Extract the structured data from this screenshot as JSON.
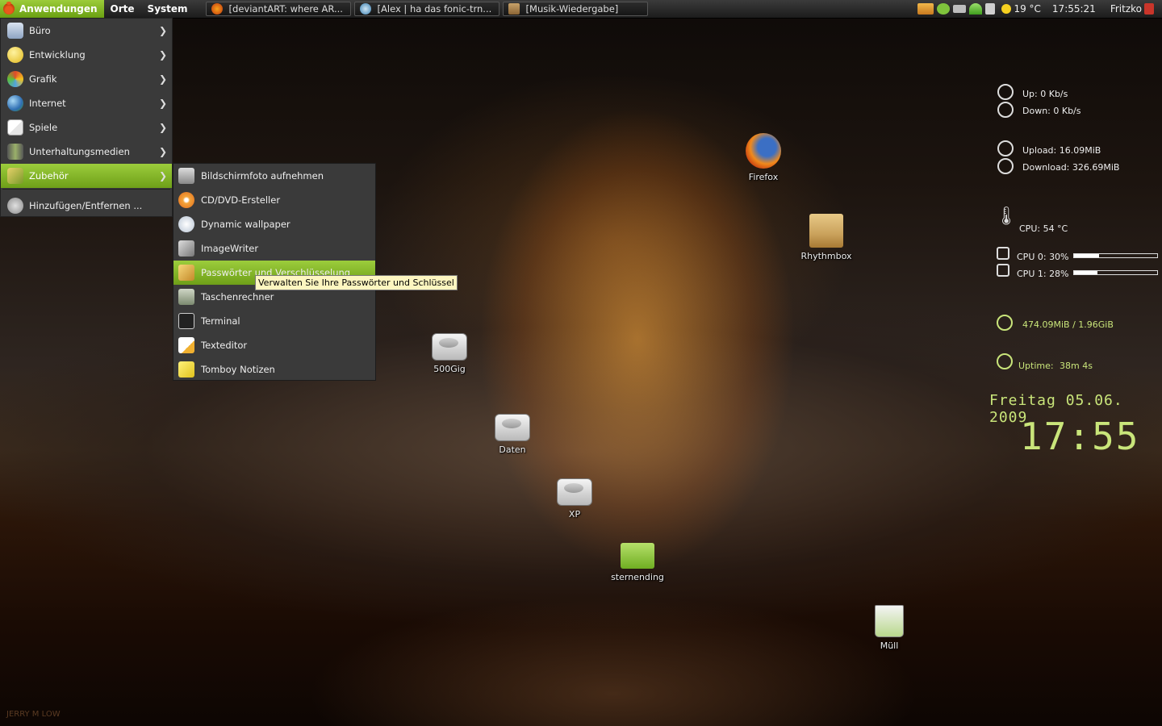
{
  "panel": {
    "menus": [
      "Anwendungen",
      "Orte",
      "System"
    ],
    "tasks": [
      "[deviantART: where AR...",
      "[Alex | ha das fonic-trn...",
      "[Musik-Wiedergabe]"
    ],
    "weather": "19 °C",
    "time": "17:55:21",
    "user": "Fritzko"
  },
  "main_menu": {
    "items": [
      {
        "label": "Büro",
        "icon": "office-icon"
      },
      {
        "label": "Entwicklung",
        "icon": "development-icon"
      },
      {
        "label": "Grafik",
        "icon": "graphics-icon"
      },
      {
        "label": "Internet",
        "icon": "globe-icon"
      },
      {
        "label": "Spiele",
        "icon": "cards-icon"
      },
      {
        "label": "Unterhaltungsmedien",
        "icon": "film-icon"
      },
      {
        "label": "Zubehör",
        "icon": "accessories-icon"
      }
    ],
    "add_remove": "Hinzufügen/Entfernen ...",
    "selected": "Zubehör"
  },
  "submenu": {
    "items": [
      "Bildschirmfoto aufnehmen",
      "CD/DVD-Ersteller",
      "Dynamic wallpaper",
      "ImageWriter",
      "Passwörter und Verschlüsselung",
      "Taschenrechner",
      "Terminal",
      "Texteditor",
      "Tomboy Notizen"
    ],
    "selected": "Passwörter und Verschlüsselung",
    "tooltip": "Verwalten Sie Ihre Passwörter und Schlüssel"
  },
  "desktop": {
    "icons": [
      "Firefox",
      "Rhythmbox",
      "500Gig",
      "Daten",
      "XP",
      "sternending",
      "Müll"
    ]
  },
  "conky": {
    "up": "Up: 0 Kb/s",
    "down": "Down: 0 Kb/s",
    "upload": "Upload: 16.09MiB",
    "download": "Download: 326.69MiB",
    "cpu_temp": "CPU: 54 °C",
    "cpu0": {
      "label": "CPU 0: 30%",
      "value": 0.3
    },
    "cpu1": {
      "label": "CPU 1: 28%",
      "value": 0.28
    },
    "mem": "474.09MiB / 1.96GiB",
    "uptime_label": "Uptime:",
    "uptime": "38m 4s",
    "date": "Freitag 05.06. 2009",
    "clock": "17:55"
  },
  "wallpaper_credit": "JERRY M LOW",
  "colors": {
    "accent": "#8ab82a",
    "conky_green": "#c9e57a"
  }
}
